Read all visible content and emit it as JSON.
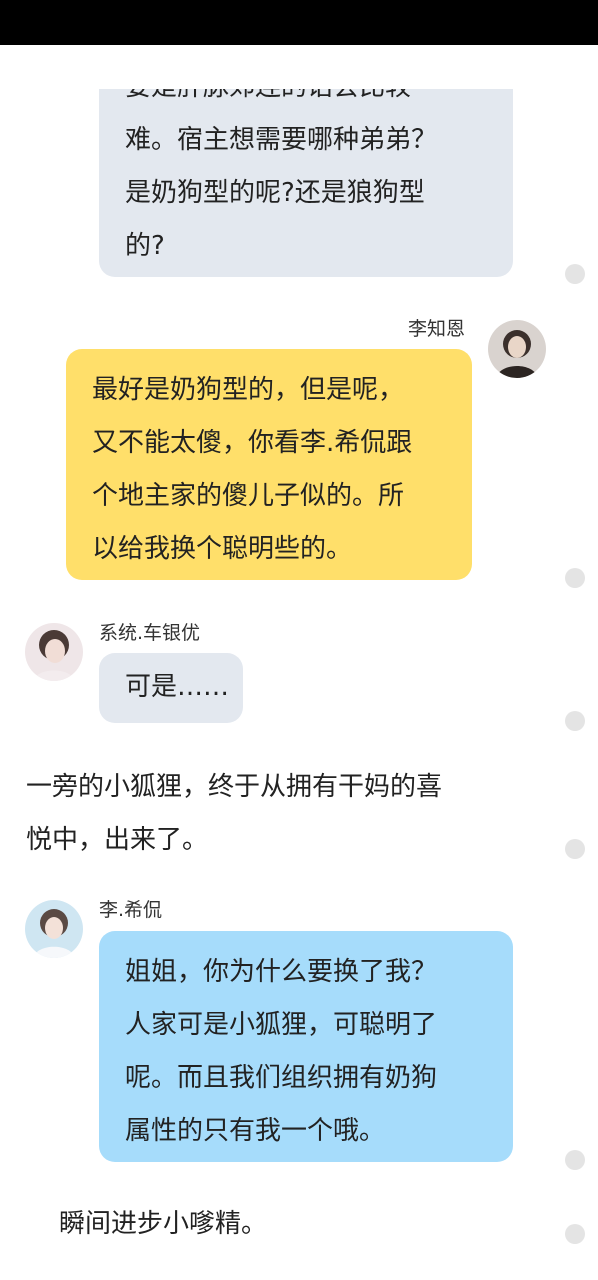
{
  "messages": {
    "m1": {
      "lines": [
        "要是肝脉郊连的话会比较",
        "难。宿主想需要哪种弟弟？",
        "是奶狗型的呢?还是狼狗型",
        "的?"
      ],
      "color": "#e3e8ef"
    },
    "m2": {
      "speaker": "李知恩",
      "lines": [
        "最好是奶狗型的，但是呢，",
        "又不能太傻，你看李.希侃跟",
        "个地主家的傻儿子似的。所",
        "以给我换个聪明些的。"
      ],
      "color": "#ffdf6a"
    },
    "m3": {
      "speaker": "系统.车银优",
      "lines": [
        "可是……"
      ],
      "color": "#e3e8ef"
    },
    "m4": {
      "speaker": "李.希侃",
      "lines": [
        "姐姐，你为什么要换了我？",
        "人家可是小狐狸，可聪明了",
        "呢。而且我们组织拥有奶狗",
        "属性的只有我一个哦。"
      ],
      "color": "#a6dcfb"
    }
  },
  "narration": {
    "n1": [
      "    一旁的小狐狸，终于从拥有干妈的喜",
      "悦中，出来了。"
    ],
    "n2": [
      "    瞬间进步小嗲精。"
    ]
  },
  "avatars": {
    "li_zhien": "avatar-icon",
    "che_yinyou": "avatar-icon",
    "li_xikan": "avatar-icon"
  }
}
